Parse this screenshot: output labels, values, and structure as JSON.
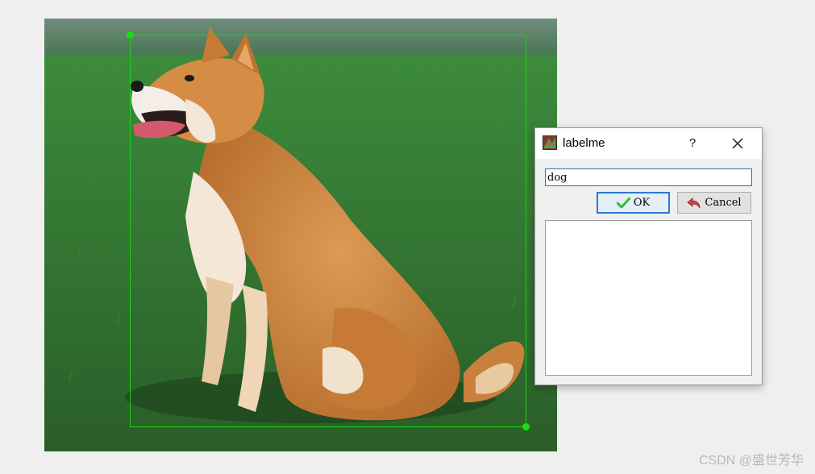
{
  "canvas": {
    "image_alt": "Shiba Inu dog sitting on green grass",
    "bbox_color": "#18d418"
  },
  "dialog": {
    "title": "labelme",
    "help_label": "?",
    "label_value": "dog",
    "ok_label": "OK",
    "cancel_label": "Cancel",
    "label_list": []
  },
  "colors": {
    "focus_border": "#2a7ad6",
    "ok_check": "#3cb43c",
    "cancel_arrow": "#d43f3f"
  },
  "icons": {
    "app": "labelme-app-icon",
    "help": "question-icon",
    "close": "close-icon",
    "ok": "checkmark-icon",
    "cancel": "undo-arrow-icon"
  },
  "watermark": "CSDN @盛世芳华"
}
